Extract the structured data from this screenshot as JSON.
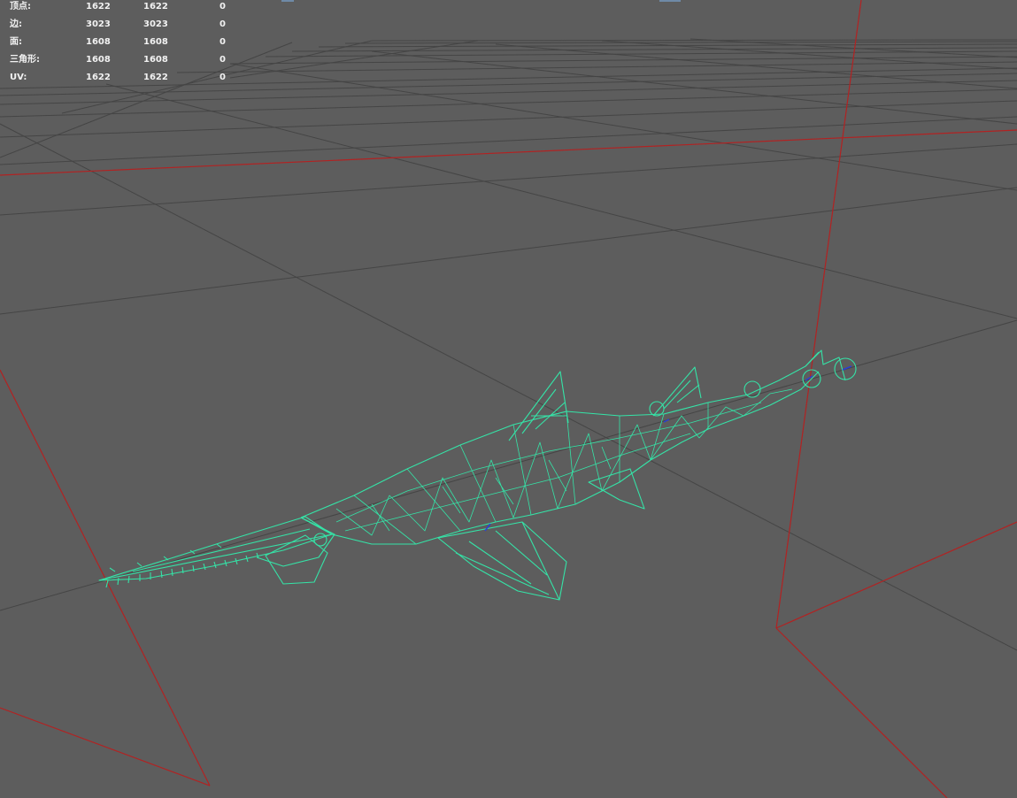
{
  "viewport": {
    "name": "3D perspective viewport",
    "background": "#5d5d5d",
    "grid_color": "#4a4a4a",
    "axis_color": "#b22222",
    "wireframe_color": "#35e3a7"
  },
  "hud": {
    "rows": [
      {
        "label": "顶点:",
        "v1": "1622",
        "v2": "1622",
        "v3": "0"
      },
      {
        "label": "边:",
        "v1": "3023",
        "v2": "3023",
        "v3": "0"
      },
      {
        "label": "面:",
        "v1": "1608",
        "v2": "1608",
        "v3": "0"
      },
      {
        "label": "三角形:",
        "v1": "1608",
        "v2": "1608",
        "v3": "0"
      },
      {
        "label": "UV:",
        "v1": "1622",
        "v2": "1622",
        "v3": "0"
      }
    ]
  }
}
